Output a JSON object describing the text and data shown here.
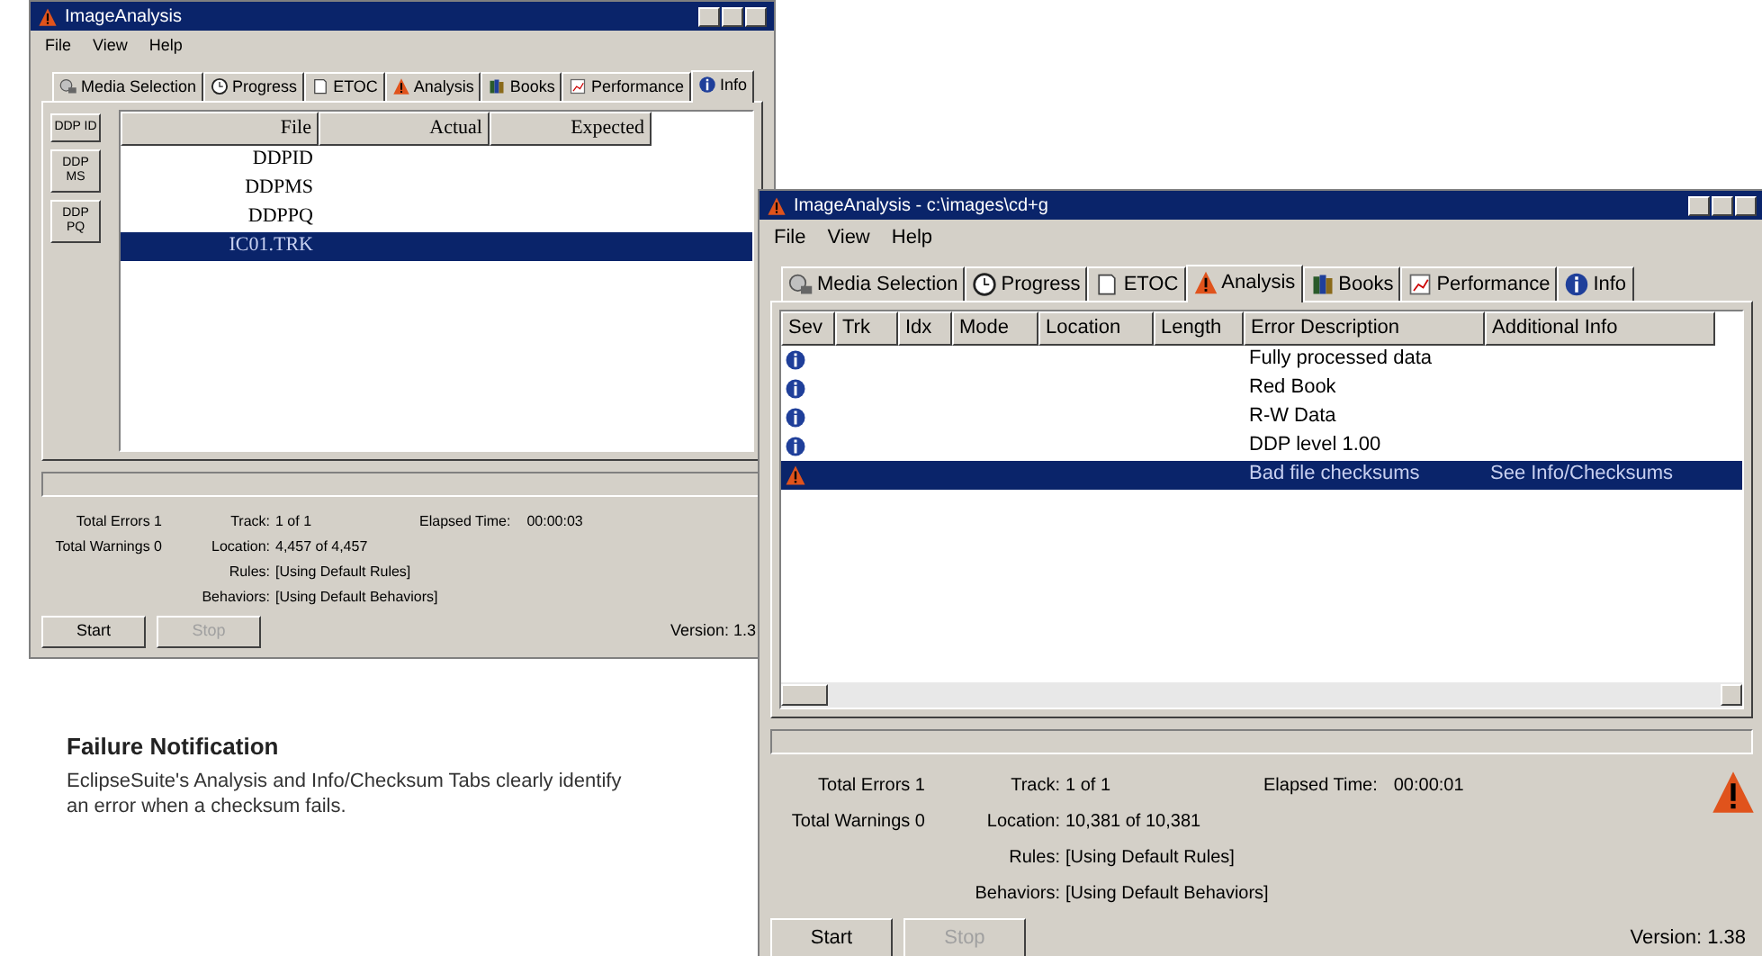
{
  "windows": [
    {
      "title": "ImageAnalysis",
      "menu": [
        "File",
        "View",
        "Help"
      ],
      "tabs": [
        {
          "label": "Media Selection",
          "selected": false
        },
        {
          "label": "Progress",
          "selected": false
        },
        {
          "label": "ETOC",
          "selected": false
        },
        {
          "label": "Analysis",
          "selected": false
        },
        {
          "label": "Books",
          "selected": false
        },
        {
          "label": "Performance",
          "selected": false
        },
        {
          "label": "Info",
          "selected": true
        }
      ],
      "progress": {
        "level": 0
      },
      "side_buttons": [
        {
          "label": "DDP ID",
          "selected": false
        },
        {
          "label": "DDP MS",
          "selected": false
        },
        {
          "label": "DDP PQ",
          "selected": false
        }
      ],
      "table": {
        "kind": "checksums",
        "columns": [
          "File",
          "Actual",
          "Expected"
        ],
        "rows": [
          {
            "cells": [
              "DDPID"
            ],
            "selected": false
          },
          {
            "cells": [
              "DDPMS"
            ],
            "selected": false
          },
          {
            "cells": [
              "DDPPQ"
            ],
            "selected": false
          },
          {
            "cells": [
              "IC01.TRK"
            ],
            "selected": true
          }
        ]
      },
      "status": {
        "total_errors": "Total Errors 1",
        "track_label": "Track:",
        "track": "1 of 1",
        "elapsed_label": "Elapsed Time:",
        "elapsed": "00:00:03",
        "total_warnings": "Total Warnings 0",
        "location_label": "Location:",
        "location": "4,457 of 4,457",
        "rules_label": "Rules:",
        "rules": "[Using Default Rules]",
        "behavior_label": "Behaviors:",
        "behavior": "[Using Default Behaviors]"
      },
      "buttons": [
        {
          "label": "Start",
          "disabled": false
        },
        {
          "label": "Stop",
          "disabled": true
        }
      ],
      "version": "Version: 1.3"
    },
    {
      "title": "ImageAnalysis - c:\\images\\cd+g",
      "menu": [
        "File",
        "View",
        "Help"
      ],
      "tabs": [
        {
          "label": "Media Selection",
          "selected": false
        },
        {
          "label": "Progress",
          "selected": false
        },
        {
          "label": "ETOC",
          "selected": false
        },
        {
          "label": "Analysis",
          "selected": true
        },
        {
          "label": "Books",
          "selected": false
        },
        {
          "label": "Performance",
          "selected": false
        },
        {
          "label": "Info",
          "selected": false
        }
      ],
      "progress": {
        "level": 0
      },
      "table": {
        "kind": "errors",
        "columns": [
          "Sev",
          "Trk",
          "Idx",
          "Mode",
          "Location",
          "Length",
          "Error Description",
          "Additional Info"
        ],
        "rows": [
          {
            "kind": "info",
            "description": "Fully processed data",
            "selected": false
          },
          {
            "kind": "info",
            "description": "Red Book",
            "selected": false
          },
          {
            "kind": "info",
            "description": "R-W Data",
            "selected": false
          },
          {
            "kind": "info",
            "description": "DDP level 1.00",
            "selected": false
          },
          {
            "kind": "warning",
            "description": "Bad file checksums",
            "additional": "See Info/Checksums",
            "selected": true
          }
        ]
      },
      "status": {
        "total_errors": "Total Errors 1",
        "track_label": "Track:",
        "track": "1 of 1",
        "elapsed_label": "Elapsed Time:",
        "elapsed": "00:00:01",
        "total_warnings": "Total Warnings 0",
        "location_label": "Location:",
        "location": "10,381 of 10,381",
        "rules_label": "Rules:",
        "rules": "[Using Default Rules]",
        "behavior_label": "Behaviors:",
        "behavior": "[Using Default Behaviors]",
        "alert": true
      },
      "buttons": [
        {
          "label": "Start",
          "disabled": false
        },
        {
          "label": "Stop",
          "disabled": true
        }
      ],
      "version": "Version: 1.38"
    }
  ],
  "caption": {
    "heading": "Failure Notification",
    "text": "EclipseSuite's Analysis and Info/Checksum Tabs clearly identify an error when a checksum fails."
  }
}
